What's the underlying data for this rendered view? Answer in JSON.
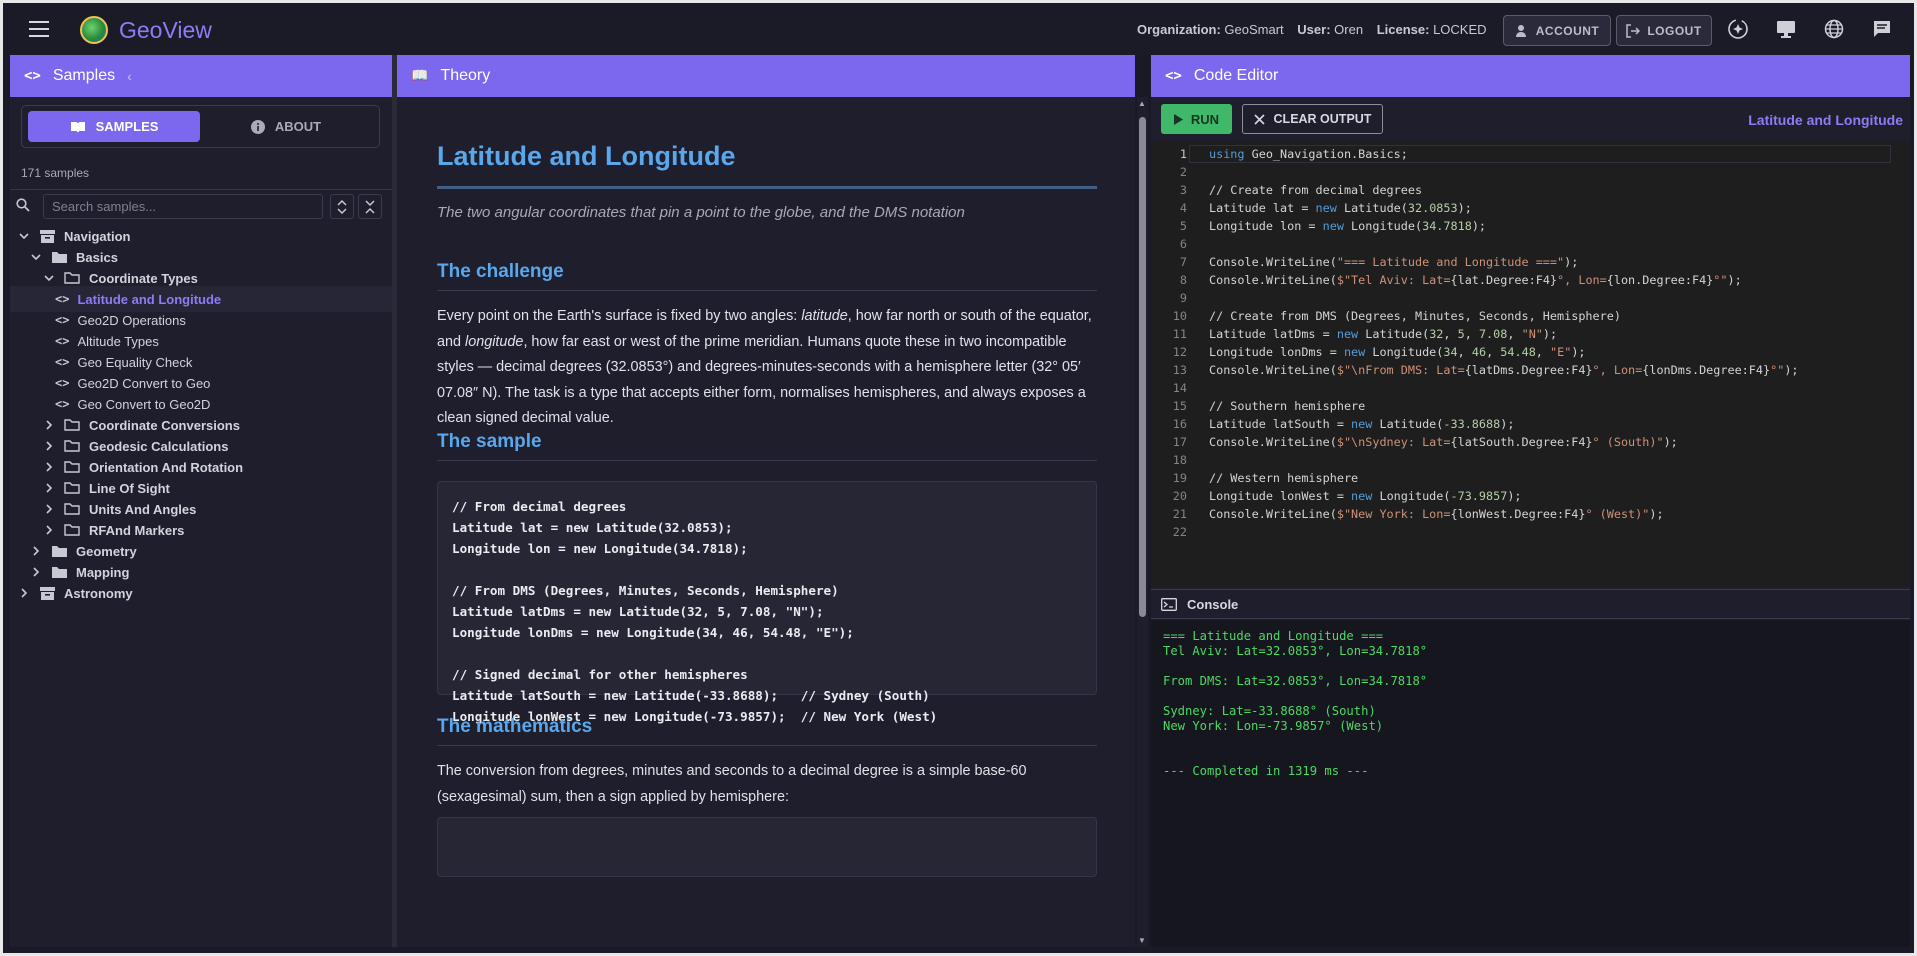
{
  "app": {
    "title": "GeoView"
  },
  "header": {
    "org_label": "Organization:",
    "org_value": "GeoSmart",
    "user_label": "User:",
    "user_value": "Oren",
    "license_label": "License:",
    "license_value": "LOCKED",
    "account_label": "ACCOUNT",
    "logout_label": "LOGOUT"
  },
  "panels": {
    "samples": "Samples",
    "theory": "Theory",
    "editor": "Code Editor"
  },
  "left": {
    "tab_samples": "SAMPLES",
    "tab_about": "ABOUT",
    "count": "171 samples",
    "search_placeholder": "Search samples...",
    "tree": [
      {
        "label": "Navigation",
        "kind": "root"
      },
      {
        "label": "Basics",
        "kind": "folder"
      },
      {
        "label": "Coordinate Types",
        "kind": "folder-open"
      },
      {
        "label": "Latitude and Longitude",
        "kind": "item",
        "selected": true
      },
      {
        "label": "Geo2D Operations",
        "kind": "item"
      },
      {
        "label": "Altitude Types",
        "kind": "item"
      },
      {
        "label": "Geo Equality Check",
        "kind": "item"
      },
      {
        "label": "Geo2D Convert to Geo",
        "kind": "item"
      },
      {
        "label": "Geo Convert to Geo2D",
        "kind": "item"
      },
      {
        "label": "Coordinate Conversions",
        "kind": "folder-closed"
      },
      {
        "label": "Geodesic Calculations",
        "kind": "folder-closed"
      },
      {
        "label": "Orientation And Rotation",
        "kind": "folder-closed"
      },
      {
        "label": "Line Of Sight",
        "kind": "folder-closed"
      },
      {
        "label": "Units And Angles",
        "kind": "folder-closed"
      },
      {
        "label": "RFAnd Markers",
        "kind": "folder-closed"
      },
      {
        "label": "Geometry",
        "kind": "folder"
      },
      {
        "label": "Mapping",
        "kind": "folder"
      },
      {
        "label": "Astronomy",
        "kind": "root"
      }
    ]
  },
  "theory": {
    "title": "Latitude and Longitude",
    "subtitle": "The two angular coordinates that pin a point to the globe, and the DMS notation",
    "h_challenge": "The challenge",
    "p_challenge_1": "Every point on the Earth's surface is fixed by two angles: ",
    "p_challenge_lat": "latitude",
    "p_challenge_2": ", how far north or south of the equator, and ",
    "p_challenge_lon": "longitude",
    "p_challenge_3": ", how far east or west of the prime meridian. Humans quote these in two incompatible styles — decimal degrees (32.0853°) and degrees-minutes-seconds with a hemisphere letter (32° 05′ 07.08″ N). The task is a type that accepts either form, normalises hemispheres, and always exposes a clean signed decimal value.",
    "h_sample": "The sample",
    "sample_code": "// From decimal degrees\nLatitude lat = new Latitude(32.0853);\nLongitude lon = new Longitude(34.7818);\n\n// From DMS (Degrees, Minutes, Seconds, Hemisphere)\nLatitude latDms = new Latitude(32, 5, 7.08, \"N\");\nLongitude lonDms = new Longitude(34, 46, 54.48, \"E\");\n\n// Signed decimal for other hemispheres\nLatitude latSouth = new Latitude(-33.8688);   // Sydney (South)\nLongitude lonWest = new Longitude(-73.9857);  // New York (West)",
    "h_math": "The mathematics",
    "p_math": "The conversion from degrees, minutes and seconds to a decimal degree is a simple base-60 (sexagesimal) sum, then a sign applied by hemisphere:"
  },
  "editor": {
    "run_label": "RUN",
    "clear_label": "CLEAR OUTPUT",
    "current_sample": "Latitude and Longitude",
    "lines": [
      "using Geo_Navigation.Basics;",
      "",
      "// Create from decimal degrees",
      "Latitude lat = new Latitude(32.0853);",
      "Longitude lon = new Longitude(34.7818);",
      "",
      "Console.WriteLine(\"=== Latitude and Longitude ===\");",
      "Console.WriteLine($\"Tel Aviv: Lat={lat.Degree:F4}°, Lon={lon.Degree:F4}°\");",
      "",
      "// Create from DMS (Degrees, Minutes, Seconds, Hemisphere)",
      "Latitude latDms = new Latitude(32, 5, 7.08, \"N\");",
      "Longitude lonDms = new Longitude(34, 46, 54.48, \"E\");",
      "Console.WriteLine($\"\\nFrom DMS: Lat={latDms.Degree:F4}°, Lon={lonDms.Degree:F4}°\");",
      "",
      "// Southern hemisphere",
      "Latitude latSouth = new Latitude(-33.8688);",
      "Console.WriteLine($\"\\nSydney: Lat={latSouth.Degree:F4}° (South)\");",
      "",
      "// Western hemisphere",
      "Longitude lonWest = new Longitude(-73.9857);",
      "Console.WriteLine($\"New York: Lon={lonWest.Degree:F4}° (West)\");",
      ""
    ]
  },
  "console": {
    "title": "Console",
    "lines": [
      "=== Latitude and Longitude ===",
      "Tel Aviv: Lat=32.0853°, Lon=34.7818°",
      "",
      "From DMS: Lat=32.0853°, Lon=34.7818°",
      "",
      "Sydney: Lat=-33.8688° (South)",
      "New York: Lon=-73.9857° (West)",
      "",
      "",
      "--- Completed in 1319 ms ---"
    ]
  },
  "colors": {
    "accent": "#7b68ee",
    "link": "#5aa7ec",
    "run": "#3fb86a",
    "console_text": "#4cd964"
  }
}
